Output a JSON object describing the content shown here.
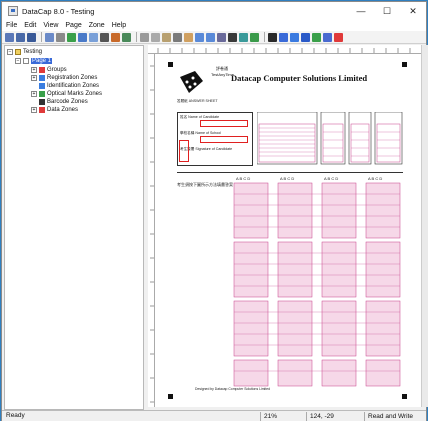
{
  "window": {
    "title": "DataCap 8.0 - Testing",
    "minimize": "—",
    "maximize": "☐",
    "close": "✕"
  },
  "menu": [
    "File",
    "Edit",
    "View",
    "Page",
    "Zone",
    "Help"
  ],
  "toolbar_icons": [
    "new-icon",
    "open-icon",
    "save-icon",
    "print-icon",
    "text-icon",
    "draw-icon",
    "scan-icon",
    "image-icon",
    "down-icon",
    "export-icon",
    "import-icon",
    "cut-icon",
    "copy-icon",
    "paste-icon",
    "grid-icon",
    "hand-icon",
    "zoom-in-icon",
    "zoom-out-icon",
    "rotate-icon",
    "frame-icon",
    "grid2-icon",
    "pointer-icon",
    "zone-icon",
    "mark-icon",
    "ocr-icon",
    "check-icon",
    "id-icon",
    "color-icon"
  ],
  "tree": {
    "root": "Testing",
    "page": "Page 1",
    "items": [
      {
        "label": "Groups",
        "color": "#e03a3a"
      },
      {
        "label": "Registration Zones",
        "color": "#3a7de0"
      },
      {
        "label": "Identification Zones",
        "color": "#3a7de0"
      },
      {
        "label": "Optical Marks Zones",
        "color": "#3aa04a"
      },
      {
        "label": "Barcode Zones",
        "color": "#333333"
      },
      {
        "label": "Data Zones",
        "color": "#e03a3a"
      }
    ]
  },
  "status": {
    "ready": "Ready",
    "zoom": "21%",
    "coords": "124, -29",
    "mode": "Read and Write"
  },
  "sheet": {
    "company": "Datacap Computer Solutions Limited",
    "logo_caption": "評卷通 TestAnyTime",
    "answer_sheet_label": "答題紙 ANSWER SHEET",
    "name_label": "姓名 Name of Candidate",
    "school_label": "學校名稱 Name of School",
    "signature_label": "考生簽署 Signature of Candidate",
    "instruction_label": "考生須按下圖所示方法填畫答案",
    "column_header": "A B C D",
    "footer": "Designed by Datacap Computer Solutions Limited"
  },
  "colors": {
    "accent": "#2f7fc0",
    "pink": "#c8408a",
    "red_zone": "#e02020"
  }
}
